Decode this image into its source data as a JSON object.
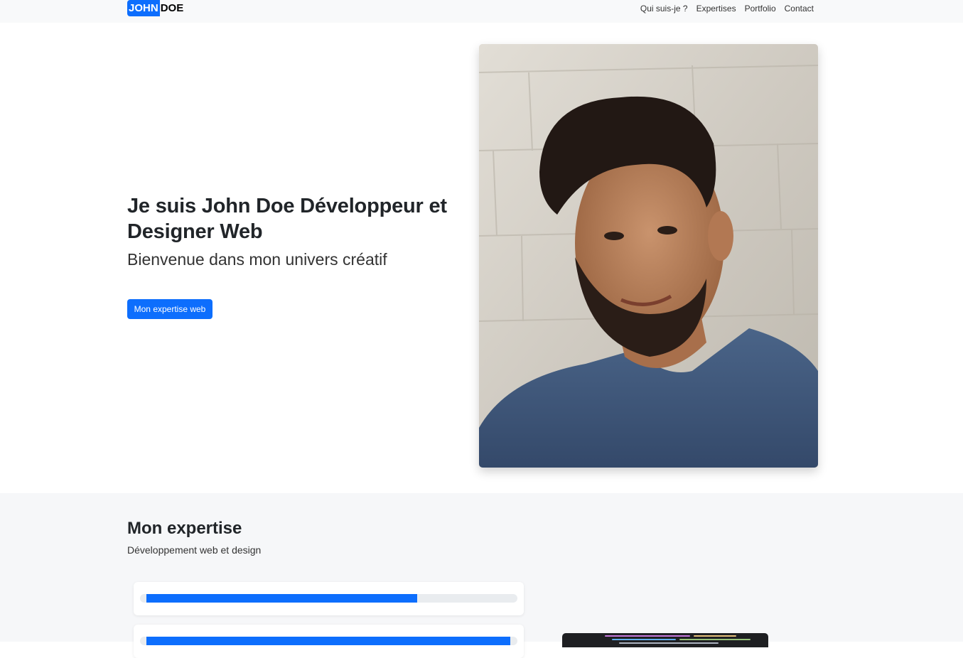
{
  "navbar": {
    "brand_first": "JOHN",
    "brand_last": "DOE",
    "links": [
      "Qui suis-je ?",
      "Expertises",
      "Portfolio",
      "Contact"
    ]
  },
  "hero": {
    "title": "Je suis John Doe Développeur et Designer Web",
    "subtitle": "Bienvenue dans mon univers créatif",
    "button_label": "Mon expertise web",
    "portrait_icon": "portrait-photo"
  },
  "expertise": {
    "title": "Mon expertise",
    "subtitle": "Développement web et design",
    "skills": [
      {
        "progress_percent": 73
      },
      {
        "progress_percent": 98
      }
    ],
    "image_icon": "code-screenshot"
  },
  "colors": {
    "accent": "#0d6efd",
    "navbar_bg": "#f8f9fa",
    "section_bg": "#f6f7f9",
    "track": "#e9ecef"
  }
}
